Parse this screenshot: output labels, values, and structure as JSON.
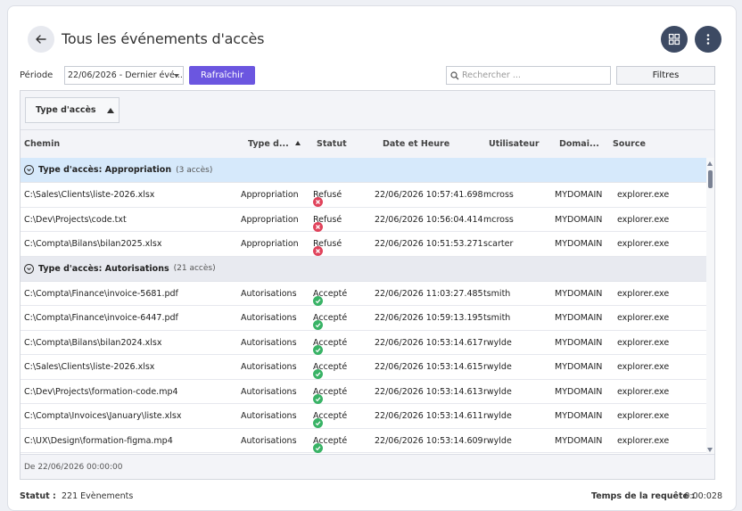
{
  "header": {
    "title": "Tous les événements d'accès"
  },
  "toolbar": {
    "period_label": "Période",
    "period_value": "22/06/2026 - Dernier évé...",
    "refresh_label": "Rafraîchir",
    "search_placeholder": "Rechercher ...",
    "filters_label": "Filtres"
  },
  "group_panel": {
    "chip_label": "Type d'accès"
  },
  "columns": {
    "path": "Chemin",
    "type": "Type d...",
    "status": "Statut",
    "date": "Date et Heure",
    "user": "Utilisateur",
    "domain": "Domai...",
    "source": "Source"
  },
  "groups": [
    {
      "label": "Type d'accès: Appropriation",
      "count": "(3 accès)",
      "rows": [
        {
          "path": "C:\\Sales\\Clients\\liste-2026.xlsx",
          "type": "Appropriation",
          "status": "Refusé",
          "date": "22/06/2026 10:57:41.698",
          "user": "mcross",
          "domain": "MYDOMAIN",
          "source": "explorer.exe"
        },
        {
          "path": "C:\\Dev\\Projects\\code.txt",
          "type": "Appropriation",
          "status": "Refusé",
          "date": "22/06/2026 10:56:04.414",
          "user": "mcross",
          "domain": "MYDOMAIN",
          "source": "explorer.exe"
        },
        {
          "path": "C:\\Compta\\Bilans\\bilan2025.xlsx",
          "type": "Appropriation",
          "status": "Refusé",
          "date": "22/06/2026 10:51:53.271",
          "user": "scarter",
          "domain": "MYDOMAIN",
          "source": "explorer.exe"
        }
      ]
    },
    {
      "label": "Type d'accès: Autorisations",
      "count": "(21 accès)",
      "rows": [
        {
          "path": "C:\\Compta\\Finance\\invoice-5681.pdf",
          "type": "Autorisations",
          "status": "Accepté",
          "date": "22/06/2026 11:03:27.485",
          "user": "tsmith",
          "domain": "MYDOMAIN",
          "source": "explorer.exe"
        },
        {
          "path": "C:\\Compta\\Finance\\invoice-6447.pdf",
          "type": "Autorisations",
          "status": "Accepté",
          "date": "22/06/2026 10:59:13.195",
          "user": "tsmith",
          "domain": "MYDOMAIN",
          "source": "explorer.exe"
        },
        {
          "path": "C:\\Compta\\Bilans\\bilan2024.xlsx",
          "type": "Autorisations",
          "status": "Accepté",
          "date": "22/06/2026 10:53:14.617",
          "user": "rwylde",
          "domain": "MYDOMAIN",
          "source": "explorer.exe"
        },
        {
          "path": "C:\\Sales\\Clients\\liste-2026.xlsx",
          "type": "Autorisations",
          "status": "Accepté",
          "date": "22/06/2026 10:53:14.615",
          "user": "rwylde",
          "domain": "MYDOMAIN",
          "source": "explorer.exe"
        },
        {
          "path": "C:\\Dev\\Projects\\formation-code.mp4",
          "type": "Autorisations",
          "status": "Accepté",
          "date": "22/06/2026 10:53:14.613",
          "user": "rwylde",
          "domain": "MYDOMAIN",
          "source": "explorer.exe"
        },
        {
          "path": "C:\\Compta\\Invoices\\January\\liste.xlsx",
          "type": "Autorisations",
          "status": "Accepté",
          "date": "22/06/2026 10:53:14.611",
          "user": "rwylde",
          "domain": "MYDOMAIN",
          "source": "explorer.exe"
        },
        {
          "path": "C:\\UX\\Design\\formation-figma.mp4",
          "type": "Autorisations",
          "status": "Accepté",
          "date": "22/06/2026 10:53:14.609",
          "user": "rwylde",
          "domain": "MYDOMAIN",
          "source": "explorer.exe"
        }
      ]
    }
  ],
  "grid_footer": {
    "text": "De 22/06/2026 00:00:00"
  },
  "statusbar": {
    "status_label": "Statut :",
    "status_value": "221 Evènements",
    "query_label": "Temps de la requête :",
    "query_value": "0:00:028"
  },
  "colors": {
    "accent": "#6b56e0",
    "dark_button": "#3d4a63",
    "error": "#e0435b",
    "success": "#39b366",
    "active_group": "#d6e9fb"
  }
}
